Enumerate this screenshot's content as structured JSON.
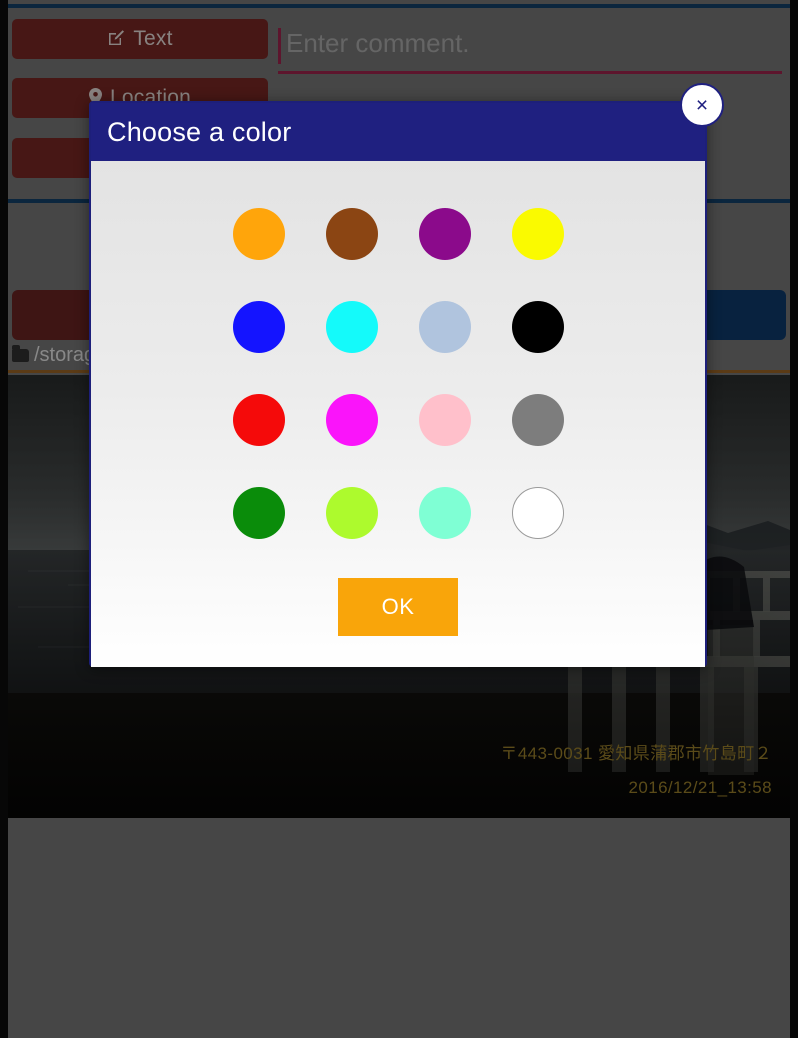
{
  "background": {
    "buttons": [
      {
        "id": "text",
        "label": "Text",
        "icon": "edit-pencil-icon"
      },
      {
        "id": "location",
        "label": "Location",
        "icon": "map-pin-icon"
      },
      {
        "id": "third",
        "label": "",
        "icon": ""
      }
    ],
    "comment_input": {
      "placeholder": "Enter comment.",
      "value": ""
    },
    "storage_path": "/storage",
    "folder_icon": "folder-icon"
  },
  "photo": {
    "overlay_address": "〒443-0031 愛知県蒲郡市竹島町２",
    "overlay_datetime": "2016/12/21_13:58",
    "overlay_color": "#8a7327"
  },
  "dialog": {
    "title": "Choose a color",
    "close_label": "×",
    "header_color": "#1f2080",
    "ok_label": "OK",
    "ok_color": "#f9a50a",
    "swatches": [
      {
        "name": "orange",
        "hex": "#FFA50B",
        "bordered": false
      },
      {
        "name": "brown",
        "hex": "#8B4513",
        "bordered": false
      },
      {
        "name": "purple",
        "hex": "#8B0A8B",
        "bordered": false
      },
      {
        "name": "yellow",
        "hex": "#FAFA00",
        "bordered": false
      },
      {
        "name": "blue",
        "hex": "#1414FF",
        "bordered": false
      },
      {
        "name": "cyan",
        "hex": "#14FAFA",
        "bordered": false
      },
      {
        "name": "lightsteelblue",
        "hex": "#B0C4DE",
        "bordered": false
      },
      {
        "name": "black",
        "hex": "#000000",
        "bordered": false
      },
      {
        "name": "red",
        "hex": "#F50A0A",
        "bordered": false
      },
      {
        "name": "magenta",
        "hex": "#FA14FA",
        "bordered": false
      },
      {
        "name": "pink",
        "hex": "#FFC0CB",
        "bordered": false
      },
      {
        "name": "gray",
        "hex": "#7D7D7D",
        "bordered": false
      },
      {
        "name": "green",
        "hex": "#0A8C0A",
        "bordered": false
      },
      {
        "name": "greenyellow",
        "hex": "#ADFA2D",
        "bordered": false
      },
      {
        "name": "aquamarine",
        "hex": "#7FFFD4",
        "bordered": false
      },
      {
        "name": "white",
        "hex": "#FFFFFF",
        "bordered": true
      }
    ]
  }
}
